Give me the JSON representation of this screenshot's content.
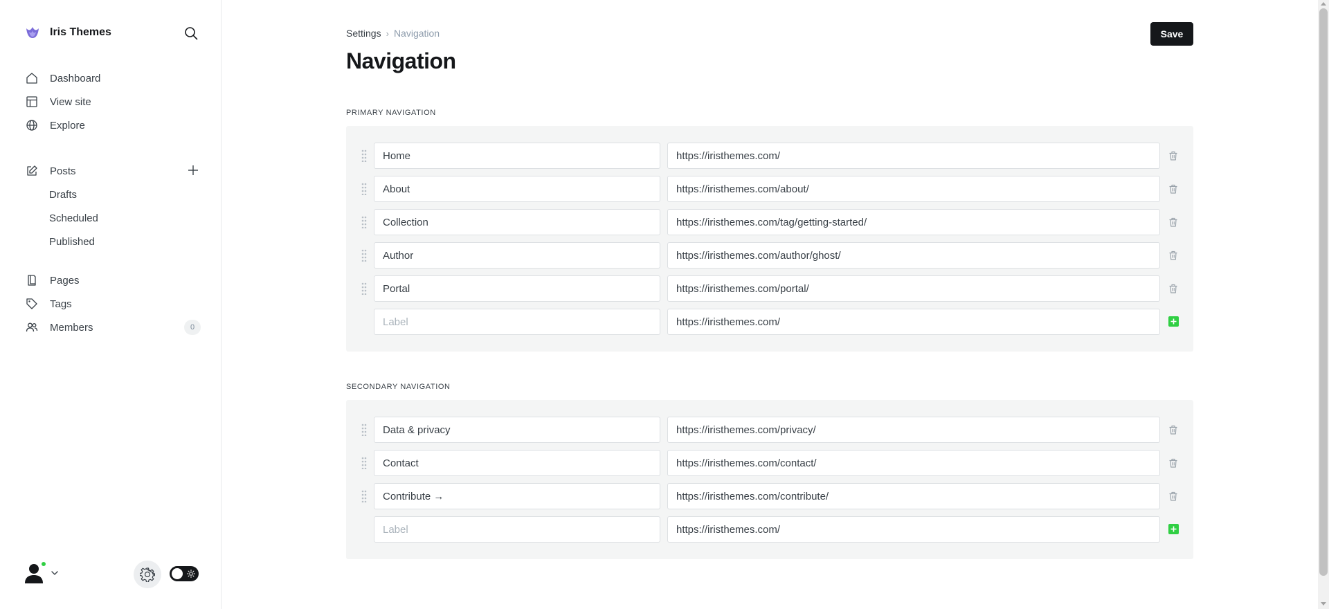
{
  "app": {
    "brand_name": "Iris Themes"
  },
  "sidebar": {
    "main_items": [
      {
        "label": "Dashboard",
        "icon": "home-icon"
      },
      {
        "label": "View site",
        "icon": "layout-icon"
      },
      {
        "label": "Explore",
        "icon": "globe-icon"
      }
    ],
    "posts": {
      "label": "Posts",
      "icon": "edit-icon",
      "sub_items": [
        "Drafts",
        "Scheduled",
        "Published"
      ]
    },
    "secondary_items": [
      {
        "label": "Pages",
        "icon": "page-icon"
      },
      {
        "label": "Tags",
        "icon": "tag-icon"
      },
      {
        "label": "Members",
        "icon": "members-icon",
        "count": "0"
      }
    ]
  },
  "header": {
    "breadcrumb_root": "Settings",
    "breadcrumb_current": "Navigation",
    "title": "Navigation",
    "save_label": "Save"
  },
  "primary": {
    "heading": "Primary navigation",
    "items": [
      {
        "label": "Home",
        "url": "https://iristhemes.com/"
      },
      {
        "label": "About",
        "url": "https://iristhemes.com/about/"
      },
      {
        "label": "Collection",
        "url": "https://iristhemes.com/tag/getting-started/"
      },
      {
        "label": "Author",
        "url": "https://iristhemes.com/author/ghost/"
      },
      {
        "label": "Portal",
        "url": "https://iristhemes.com/portal/"
      }
    ],
    "new_item": {
      "label_placeholder": "Label",
      "url": "https://iristhemes.com/"
    }
  },
  "secondary": {
    "heading": "Secondary navigation",
    "items": [
      {
        "label": "Data & privacy",
        "url": "https://iristhemes.com/privacy/"
      },
      {
        "label": "Contact",
        "url": "https://iristhemes.com/contact/"
      },
      {
        "label": "Contribute →",
        "url": "https://iristhemes.com/contribute/"
      }
    ],
    "new_item": {
      "label_placeholder": "Label",
      "url": "https://iristhemes.com/"
    }
  },
  "colors": {
    "accent_add": "#30cf43",
    "online_status": "#30cf43",
    "button_dark": "#15171a"
  }
}
